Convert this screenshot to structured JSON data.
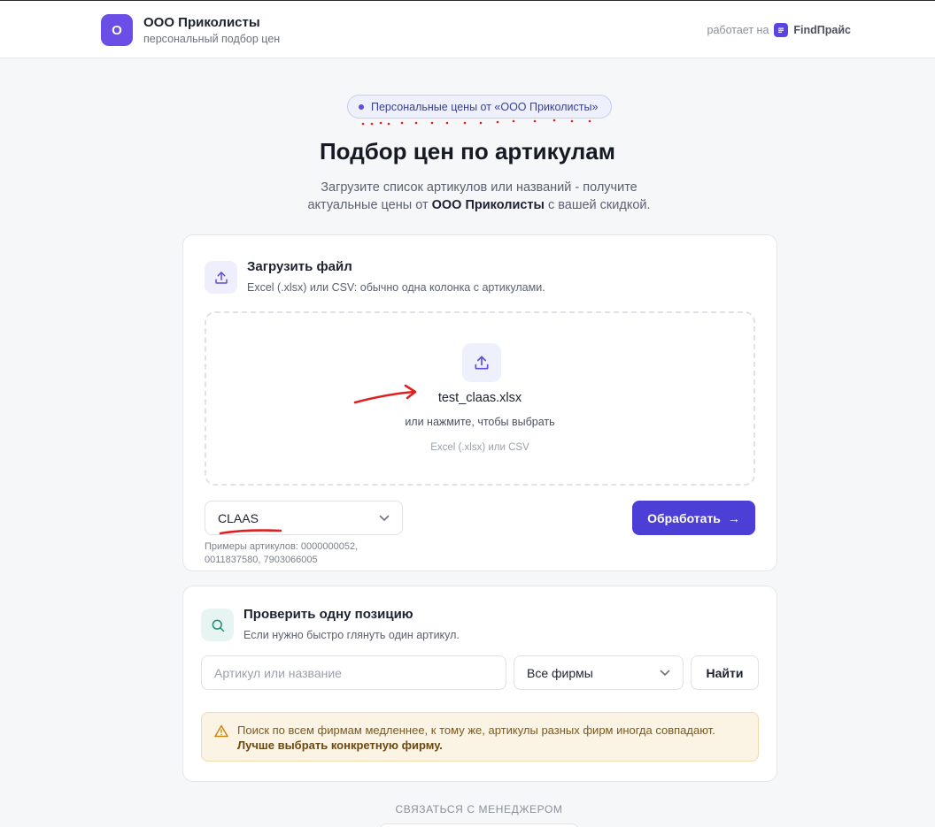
{
  "header": {
    "logo_letter": "О",
    "title": "ООО Приколисты",
    "subtitle": "персональный подбор цен",
    "powered_by": "работает на",
    "powered_brand": "FindПрайс"
  },
  "hero": {
    "pill": "Персональные цены от «ООО Приколисты»",
    "title": "Подбор цен по артикулам",
    "lead_part1": "Загрузите список артикулов или названий - получите",
    "lead_part2": "актуальные цены от ",
    "lead_company": "ООО Приколисты",
    "lead_part3": " с вашей скидкой."
  },
  "upload": {
    "title": "Загрузить файл",
    "subtitle": "Excel (.xlsx) или CSV: обычно одна колонка с артикулами.",
    "file_name": "test_claas.xlsx",
    "hint": "или нажмите, чтобы выбрать",
    "formats": "Excel (.xlsx) или CSV",
    "brand_value": "CLAAS",
    "examples": "Примеры артикулов: 0000000052, 0011837580, 7903066005",
    "process_label": "Обработать",
    "process_arrow": "→"
  },
  "single": {
    "title": "Проверить одну позицию",
    "subtitle": "Если нужно быстро глянуть один артикул.",
    "input_placeholder": "Артикул или название",
    "firm_value": "Все фирмы",
    "find_label": "Найти",
    "warning_text": "Поиск по всем фирмам медленнее, к тому же, артикулы разных фирм иногда совпадают. ",
    "warning_bold": "Лучше выбрать конкретную фирму."
  },
  "footer": {
    "contact": "СВЯЗАТЬСЯ С МЕНЕДЖЕРОМ"
  },
  "colors": {
    "accent": "#4b3fd6",
    "logo": "#6a4ee6",
    "warning_bg": "#fbf3e4",
    "annotation_red": "#e02020"
  },
  "icons": {
    "upload": "upload-icon",
    "search": "search-icon",
    "warning": "warning-icon",
    "chevron": "chevron-down-icon",
    "brand": "findprice-icon"
  }
}
